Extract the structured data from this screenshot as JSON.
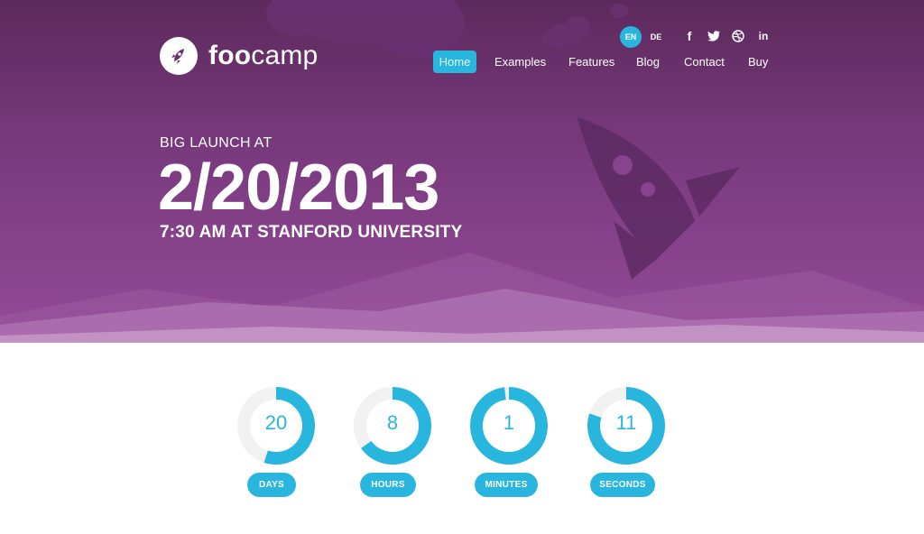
{
  "brand": {
    "name_bold": "foo",
    "name_light": "camp"
  },
  "languages": [
    {
      "code": "EN",
      "active": true
    },
    {
      "code": "DE",
      "active": false
    }
  ],
  "social_icons": [
    "facebook-icon",
    "twitter-icon",
    "dribbble-icon",
    "linkedin-icon"
  ],
  "social_labels": {
    "facebook": "f",
    "linkedin": "in"
  },
  "nav": {
    "items": [
      "Home",
      "Examples",
      "Features",
      "Blog",
      "Contact",
      "Buy"
    ],
    "active": "Home"
  },
  "hero": {
    "label": "BIG LAUNCH AT",
    "date": "2/20/2013",
    "place": "7:30 AM AT STANFORD UNIVERSITY"
  },
  "countdown": [
    {
      "value": "20",
      "unit": "DAYS",
      "progress": 0.55
    },
    {
      "value": "8",
      "unit": "HOURS",
      "progress": 0.65
    },
    {
      "value": "1",
      "unit": "MINUTES",
      "progress": 0.98
    },
    {
      "value": "11",
      "unit": "SECONDS",
      "progress": 0.8
    }
  ],
  "colors": {
    "accent": "#29b6de",
    "hero_top": "#5c2a5c",
    "hero_bottom": "#944a98",
    "text_light": "#ffffff"
  }
}
